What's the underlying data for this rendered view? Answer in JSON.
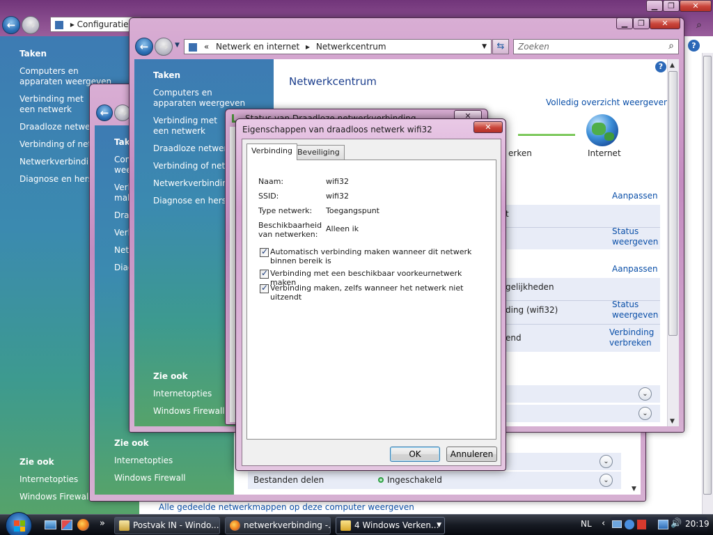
{
  "desktop": {
    "bg_top": "#5b2a63",
    "bg_bottom": "#3b6c84"
  },
  "back_window": {
    "address": "Configuraties",
    "nav_heading": "Taken",
    "nav_items": [
      "Computers en apparaten weergeven",
      "Verbinding met een netwerk maken",
      "Draadloze netwerken beheren",
      "Verbinding of netwerk instellen",
      "Netwerkverbindingen beheren",
      "Diagnose en herstel"
    ],
    "see_also_heading": "Zie ook",
    "see_also_items": [
      "Internetopties",
      "Windows Firewall"
    ],
    "bottom_link": "Alle gedeelde netwerkmappen op deze computer weergeven"
  },
  "mid_window": {
    "nav_heading": "Tak",
    "nav_items": [
      "Con",
      "wee",
      "Verb",
      "mak",
      "Draa",
      "Verb",
      "Net",
      "Diag"
    ],
    "see_also_heading": "Zie ook",
    "see_also_items": [
      "Internetopties",
      "Windows Firewall"
    ],
    "sharing_label": "Bestanden delen",
    "sharing_status": "Ingeschakeld"
  },
  "front_window": {
    "breadcrumb_prefix": "«",
    "breadcrumb": [
      "Netwerk en internet",
      "Netwerkcentrum"
    ],
    "search_placeholder": "Zoeken",
    "nav_heading": "Taken",
    "nav_items": [
      "Computers en apparaten weergeven",
      "Verbinding met een netwerk maken",
      "Draadloze netwerken beheren",
      "Verbinding of netwerk instellen",
      "Netwerkverbindingen beheren",
      "Diagnose en herstel"
    ],
    "see_also_heading": "Zie ook",
    "see_also_items": [
      "Internetopties",
      "Windows Firewall"
    ],
    "title": "Netwerkcentrum",
    "full_map_link": "Volledig overzicht weergeven",
    "map_label_partial": "erken",
    "internet_label": "Internet",
    "customize_1": "Aanpassen",
    "status_link_1": [
      "Status",
      "weergeven"
    ],
    "customize_2": "Aanpassen",
    "row_partial_1": "t",
    "row_partial_2": "gelijkheden",
    "row_partial_3": "ding (wifi32)",
    "row_partial_4": "end",
    "status_link_2": [
      "Status",
      "weergeven"
    ],
    "disconnect_link": [
      "Verbinding",
      "verbreken"
    ]
  },
  "status_window": {
    "title": "Status van Draadloze netwerkverbinding"
  },
  "dialog": {
    "title": "Eigenschappen van draadloos netwerk wifi32",
    "tabs": [
      "Verbinding",
      "Beveiliging"
    ],
    "fields": [
      {
        "label": "Naam:",
        "value": "wifi32"
      },
      {
        "label": "SSID:",
        "value": "wifi32"
      },
      {
        "label": "Type netwerk:",
        "value": "Toegangspunt"
      },
      {
        "label": "Beschikbaarheid van netwerken:",
        "value": "Alleen ik"
      }
    ],
    "checkboxes": [
      {
        "label": "Automatisch verbinding maken wanneer dit netwerk binnen bereik is",
        "checked": true
      },
      {
        "label": "Verbinding met een beschikbaar voorkeurnetwerk maken",
        "checked": true
      },
      {
        "label": "Verbinding maken, zelfs wanneer het netwerk niet uitzendt",
        "checked": true
      }
    ],
    "ok": "OK",
    "cancel": "Annuleren"
  },
  "taskbar": {
    "items": [
      "Postvak IN - Windo...",
      "netwerkverbinding -...",
      "4 Windows Verken..."
    ],
    "language": "NL",
    "clock": "20:19",
    "overflow": "»"
  }
}
